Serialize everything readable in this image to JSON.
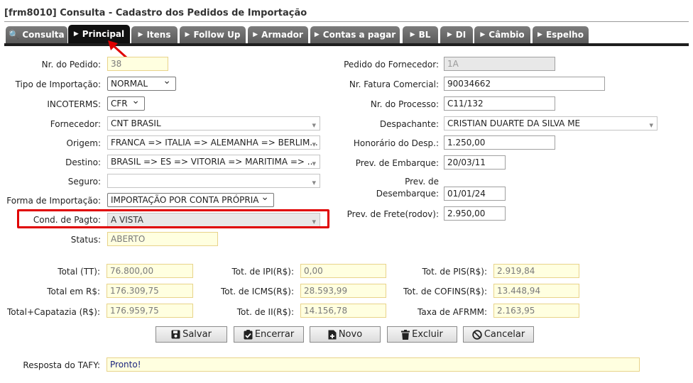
{
  "window": {
    "title": "[frm8010] Consulta - Cadastro dos Pedidos de Importação"
  },
  "tabs": [
    {
      "label": "Consulta",
      "icon": "search-icon"
    },
    {
      "label": "Principal",
      "icon": "triangle-right-icon"
    },
    {
      "label": "Itens",
      "icon": "triangle-right-icon"
    },
    {
      "label": "Follow Up",
      "icon": "triangle-right-icon"
    },
    {
      "label": "Armador",
      "icon": "triangle-right-icon"
    },
    {
      "label": "Contas a pagar",
      "icon": "triangle-right-icon"
    },
    {
      "label": "BL",
      "icon": "triangle-right-icon"
    },
    {
      "label": "DI",
      "icon": "triangle-right-icon"
    },
    {
      "label": "Câmbio",
      "icon": "triangle-right-icon"
    },
    {
      "label": "Espelho",
      "icon": "triangle-right-icon"
    }
  ],
  "active_tab": "Principal",
  "left_form": {
    "nr_pedido": {
      "label": "Nr. do Pedido:",
      "value": "38"
    },
    "tipo_importacao": {
      "label": "Tipo de Importação:",
      "value": "NORMAL"
    },
    "incoterms": {
      "label": "INCOTERMS:",
      "value": "CFR"
    },
    "fornecedor": {
      "label": "Fornecedor:",
      "value": "CNT BRASIL"
    },
    "origem": {
      "label": "Origem:",
      "value": "FRANCA => ITALIA => ALEMANHA => BERLIM..."
    },
    "destino": {
      "label": "Destino:",
      "value": "BRASIL => ES => VITORIA => MARITIMA => ..."
    },
    "seguro": {
      "label": "Seguro:",
      "value": ""
    },
    "forma_importacao": {
      "label": "Forma de Importação:",
      "value": "IMPORTAÇÃO POR CONTA PRÓPRIA"
    },
    "cond_pagto": {
      "label": "Cond. de Pagto:",
      "value": "A VISTA"
    },
    "status": {
      "label": "Status:",
      "value": "ABERTO"
    }
  },
  "right_form": {
    "pedido_fornecedor": {
      "label": "Pedido do Fornecedor:",
      "value": "1A"
    },
    "nr_fatura": {
      "label": "Nr. Fatura Comercial:",
      "value": "90034662"
    },
    "nr_processo": {
      "label": "Nr. do Processo:",
      "value": "C11/132"
    },
    "despachante": {
      "label": "Despachante:",
      "value": "CRISTIAN DUARTE DA SILVA ME"
    },
    "honorario": {
      "label": "Honorário do Desp.:",
      "value": "1.250,00"
    },
    "prev_embarque": {
      "label": "Prev. de Embarque:",
      "value": "20/03/11"
    },
    "prev_desembarque": {
      "label": "Prev. de Desembarque:",
      "value": "01/01/24"
    },
    "prev_frete": {
      "label": "Prev. de Frete(rodov):",
      "value": "2.950,00"
    }
  },
  "totals": {
    "total_tt": {
      "label": "Total (TT):",
      "value": "76.800,00"
    },
    "total_rs": {
      "label": "Total em R$:",
      "value": "176.309,75"
    },
    "total_capatazia": {
      "label": "Total+Capatazia (R$):",
      "value": "176.959,75"
    },
    "tot_ipi": {
      "label": "Tot. de IPI(R$):",
      "value": "0,00"
    },
    "tot_icms": {
      "label": "Tot. de ICMS(R$):",
      "value": "28.593,99"
    },
    "tot_ii": {
      "label": "Tot. de II(R$):",
      "value": "14.156,78"
    },
    "tot_pis": {
      "label": "Tot. de PIS(R$):",
      "value": "2.919,84"
    },
    "tot_cofins": {
      "label": "Tot. de COFINS(R$):",
      "value": "13.448,94"
    },
    "taxa_afrmm": {
      "label": "Taxa de AFRMM:",
      "value": "2.163,95"
    }
  },
  "buttons": {
    "salvar": {
      "label": "Salvar",
      "icon": "save-icon"
    },
    "encerrar": {
      "label": "Encerrar",
      "icon": "clipboard-check-icon"
    },
    "novo": {
      "label": "Novo",
      "icon": "new-document-icon"
    },
    "excluir": {
      "label": "Excluir",
      "icon": "trash-icon"
    },
    "cancelar": {
      "label": "Cancelar",
      "icon": "cancel-icon"
    }
  },
  "tafy": {
    "label": "Resposta do TAFY:",
    "value": "Pronto!"
  },
  "annotations": {
    "highlight_color": "#e00000"
  }
}
